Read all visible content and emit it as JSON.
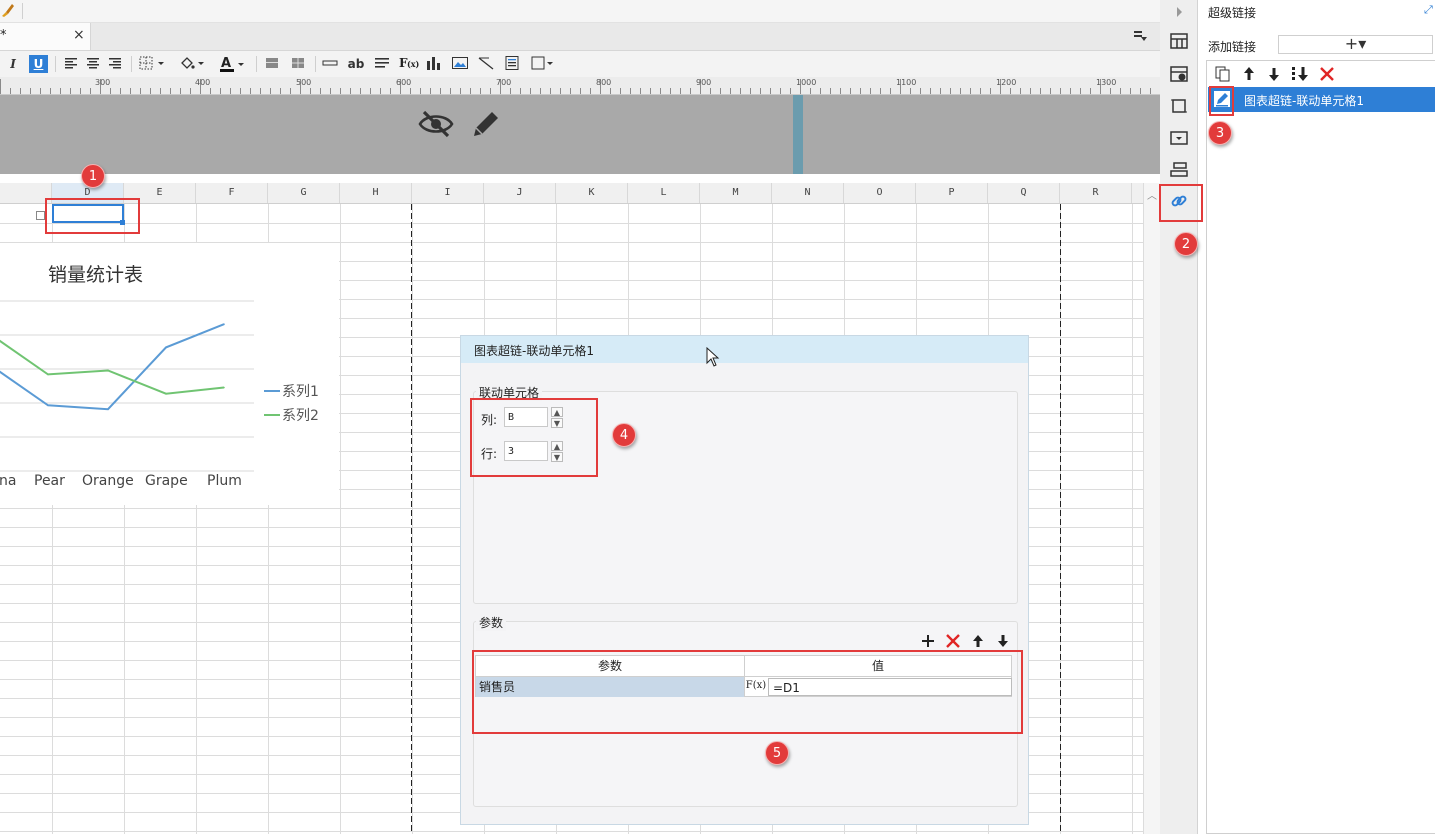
{
  "tab": {
    "name": "*",
    "close": "×"
  },
  "toolbar": {
    "italic": "I",
    "underline": "U",
    "ab": "ab"
  },
  "ruler": [
    "300",
    "400",
    "500",
    "600",
    "700",
    "800",
    "900",
    "1000",
    "1100",
    "1200",
    "1300"
  ],
  "columns": [
    "D",
    "E",
    "F",
    "G",
    "H",
    "I",
    "J",
    "K",
    "L",
    "M",
    "N",
    "O",
    "P",
    "Q",
    "R"
  ],
  "chart_data": {
    "type": "line",
    "title": "销量统计表",
    "categories": [
      "Banana",
      "Pear",
      "Orange",
      "Grape",
      "Plum"
    ],
    "visible_category_labels": [
      "na",
      "Pear",
      "Orange",
      "Grape",
      "Plum"
    ],
    "series": [
      {
        "name": "系列1",
        "values": [
          130,
          85,
          80,
          160,
          190
        ],
        "color": "#5b9bd5"
      },
      {
        "name": "系列2",
        "values": [
          170,
          125,
          130,
          100,
          108
        ],
        "color": "#70c472"
      }
    ],
    "ylim": [
      0,
      220
    ],
    "grid": true,
    "legend": "right"
  },
  "dialog": {
    "title": "图表超链-联动单元格1",
    "linked_group": "联动单元格",
    "col_label": "列:",
    "col_value": "B",
    "row_label": "行:",
    "row_value": "3",
    "params_group": "参数",
    "table_headers": [
      "参数",
      "值"
    ],
    "param_name": "销售员",
    "param_fx": "F(x)",
    "param_value": "=D1"
  },
  "panel": {
    "title": "超级链接",
    "add_label": "添加链接",
    "add_button": "+▾",
    "selected_link": "图表超链-联动单元格1"
  },
  "badges": [
    "1",
    "2",
    "3",
    "4",
    "5"
  ],
  "colors": {
    "accent": "#2e7fd6",
    "callout": "#e23b3b",
    "series1": "#5b9bd5",
    "series2": "#70c472"
  }
}
